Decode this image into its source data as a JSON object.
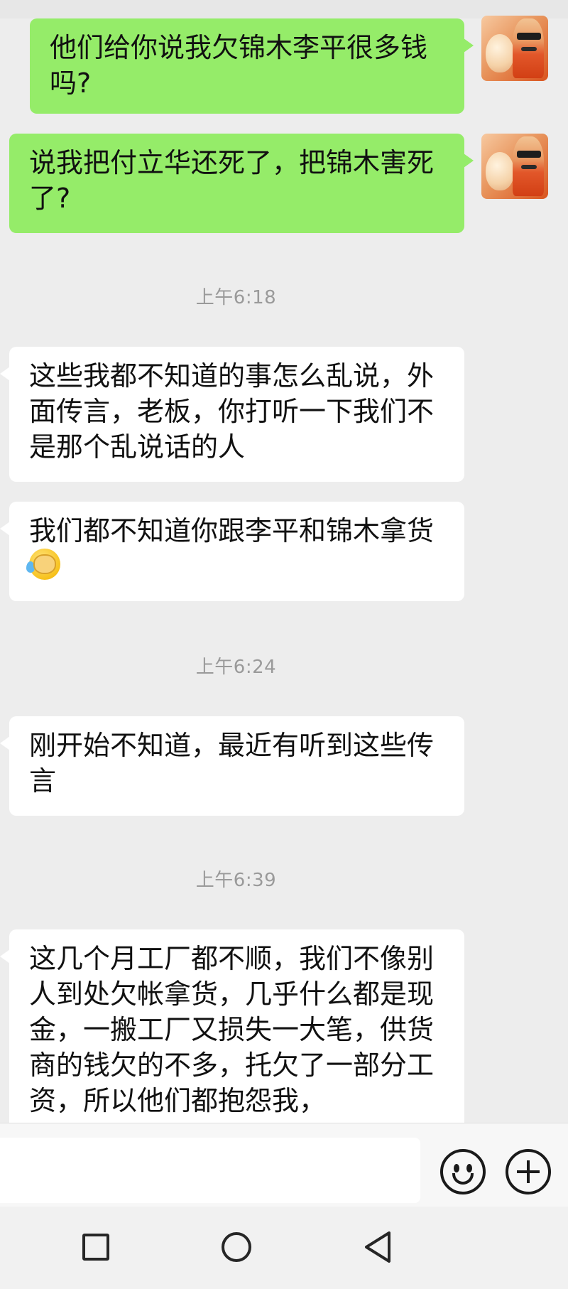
{
  "messages": [
    {
      "type": "sent",
      "text": "他们给你说我欠锦木李平很多钱吗?"
    },
    {
      "type": "sent",
      "text": "说我把付立华还死了，把锦木害死了?"
    },
    {
      "type": "time",
      "text": "上午6:18"
    },
    {
      "type": "received",
      "text": "这些我都不知道的事怎么乱说，外面传言，老板，你打听一下我们不是那个乱说话的人"
    },
    {
      "type": "received",
      "text": "我们都不知道你跟李平和锦木拿货",
      "emoji": "face-palm-crying-emoji"
    },
    {
      "type": "time",
      "text": "上午6:24"
    },
    {
      "type": "received",
      "text": "刚开始不知道，最近有听到这些传言"
    },
    {
      "type": "time",
      "text": "上午6:39"
    },
    {
      "type": "received",
      "text": "这几个月工厂都不顺，我们不像别人到处欠帐拿货，几乎什么都是现金，一搬工厂又损失一大笔，供货商的钱欠的不多，托欠了一部分工资，所以他们都抱怨我，"
    }
  ],
  "input_bar": {
    "input_value": "",
    "emoji_button_icon": "smiley-face-icon",
    "more_button_icon": "plus-circle-icon"
  },
  "nav_bar": {
    "recent_icon": "square-icon",
    "home_icon": "circle-icon",
    "back_icon": "triangle-back-icon"
  },
  "colors": {
    "background": "#ededed",
    "sent_bubble": "#95ec69",
    "received_bubble": "#ffffff",
    "timestamp": "#9a9a9a"
  }
}
